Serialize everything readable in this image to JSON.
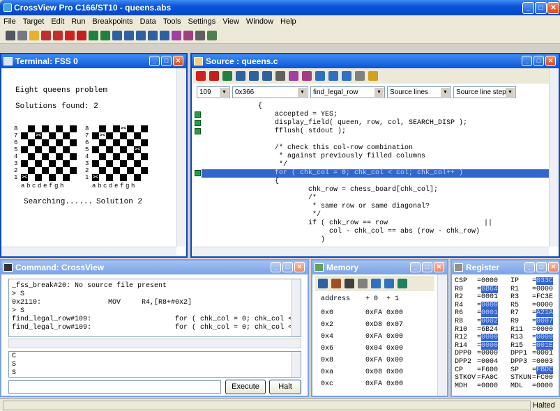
{
  "app": {
    "title": "CrossView Pro C166/ST10 - queens.abs"
  },
  "menu": [
    "File",
    "Target",
    "Edit",
    "Run",
    "Breakpoints",
    "Data",
    "Tools",
    "Settings",
    "View",
    "Window",
    "Help"
  ],
  "terminal": {
    "title": "Terminal: FSS 0",
    "heading": "Eight queens problem",
    "solutions": "Solutions found:  2",
    "left_caption": "Searching......",
    "right_caption": "Solution 2",
    "files": "abcdefgh",
    "ranks": [
      "8",
      "7",
      "6",
      "5",
      "4",
      "3",
      "2",
      "1"
    ],
    "queen": "><"
  },
  "source": {
    "title": "Source : queens.c",
    "line_no": "109",
    "address": "0x366",
    "function": "find_legal_row",
    "mode": "Source lines",
    "step": "Source line step",
    "lines": [
      "{",
      "    accepted = YES;",
      "    display_field( queen, row, col, SEARCH_DISP );",
      "    fflush( stdout );",
      "",
      "    /* check this col-row combination",
      "     * against previously filled columns",
      "     */",
      "    for ( chk_col = 0; chk_col < col; chk_col++ )",
      "    {",
      "            chk_row = chess_board[chk_col];",
      "            /*",
      "             * same row or same diagonal?",
      "             */",
      "            if ( chk_row == row                       ||",
      "                 col - chk_col == abs (row - chk_row)",
      "               )"
    ]
  },
  "command": {
    "title": "Command: CrossView",
    "output": [
      "_fss_break#20: No source file present",
      "> S",
      "0x2110:                MOV     R4,[R8+#0x2]",
      "> S",
      "find_legal_row#109:                    for ( chk_col = 0; chk_col < c",
      "find_legal_row#109:                    for ( chk_col = 0; chk_col < c"
    ],
    "history": [
      "C",
      "S",
      "S"
    ],
    "execute": "Execute",
    "halt": "Halt"
  },
  "memory": {
    "title": "Memory",
    "header_addr": "address",
    "header_cols": "+ 0  + 1",
    "rows": [
      [
        "0x0",
        "0xFA 0x00"
      ],
      [
        "0x2",
        "0xD8 0x07"
      ],
      [
        "0x4",
        "0xFA 0x00"
      ],
      [
        "0x6",
        "0x04 0x00"
      ],
      [
        "0x8",
        "0xFA 0x00"
      ],
      [
        "0xa",
        "0x08 0x00"
      ],
      [
        "0xc",
        "0xFA 0x00"
      ]
    ]
  },
  "register": {
    "title": "Register",
    "rows": [
      [
        "CSP",
        "=0000",
        "IP",
        "=033C"
      ],
      [
        "R0",
        "=6B64",
        "R1",
        "=0000"
      ],
      [
        "R2",
        "=0001",
        "R3",
        "=FC3E"
      ],
      [
        "R4",
        "=0000",
        "R5",
        "=0000"
      ],
      [
        "R6",
        "=0001",
        "R7",
        "=A21A"
      ],
      [
        "R8",
        "=0002",
        "R9",
        "=0007"
      ],
      [
        "R10",
        "=6B24",
        "R11",
        "=0000"
      ],
      [
        "R12",
        "=0000",
        "R13",
        "=0000"
      ],
      [
        "R14",
        "=0000",
        "R15",
        "=001E"
      ],
      [
        "DPP0",
        "=0000",
        "DPP1",
        "=0001"
      ],
      [
        "DPP2",
        "=0004",
        "DPP3",
        "=0003"
      ],
      [
        "CP",
        "=F600",
        "SP",
        "=FBDC"
      ],
      [
        "STKOV",
        "=FA0C",
        "STKUN",
        "=FC00"
      ],
      [
        "MDH",
        "=0000",
        "MDL",
        "=0000"
      ]
    ]
  },
  "status": {
    "text": "Halted"
  },
  "colors": {
    "title_blue": "#0a55d8",
    "highlight": "#3366cc",
    "marker": "#20a040"
  }
}
